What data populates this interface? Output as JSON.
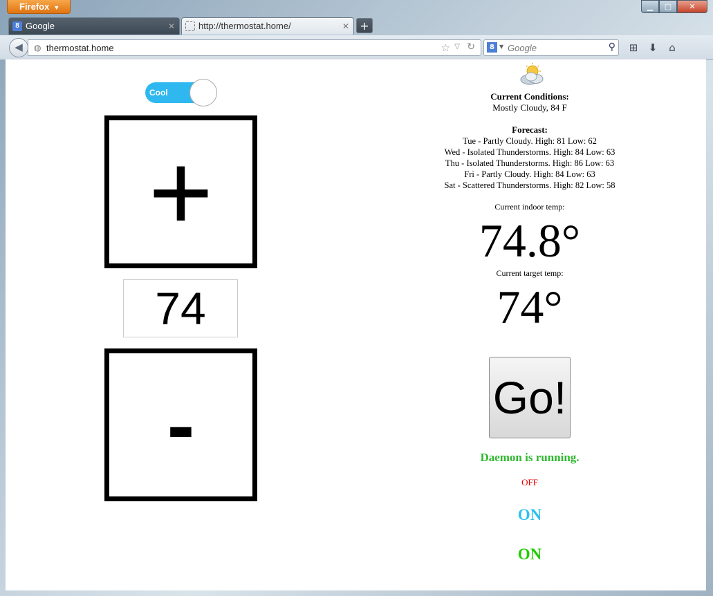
{
  "browser": {
    "menu_button": "Firefox",
    "tabs": [
      {
        "label": "Google",
        "favicon": "8"
      },
      {
        "label": "http://thermostat.home/"
      }
    ],
    "url": "thermostat.home",
    "search_placeholder": "Google",
    "search_engine_icon": "8"
  },
  "page": {
    "mode_toggle": {
      "label": "Cool",
      "color": "#2fb8ef"
    },
    "increase_label": "+",
    "decrease_label": "-",
    "setpoint_value": "74",
    "conditions_heading": "Current Conditions:",
    "conditions_text": "Mostly Cloudy, 84 F",
    "forecast_heading": "Forecast:",
    "forecast": [
      "Tue - Partly Cloudy. High: 81 Low: 62",
      "Wed - Isolated Thunderstorms. High: 84 Low: 63",
      "Thu - Isolated Thunderstorms. High: 86 Low: 63",
      "Fri - Partly Cloudy. High: 84 Low: 63",
      "Sat - Scattered Thunderstorms. High: 82 Low: 58"
    ],
    "indoor_label": "Current indoor temp:",
    "indoor_temp": "74.8°",
    "target_label": "Current target temp:",
    "target_temp": "74°",
    "go_label": "Go!",
    "daemon_status": "Daemon is running.",
    "statuses": [
      {
        "text": "OFF",
        "color": "#e60000"
      },
      {
        "text": "ON",
        "color": "#2ec0f0"
      },
      {
        "text": "ON",
        "color": "#22cc00"
      }
    ],
    "daemon_color": "#2eb82e"
  }
}
